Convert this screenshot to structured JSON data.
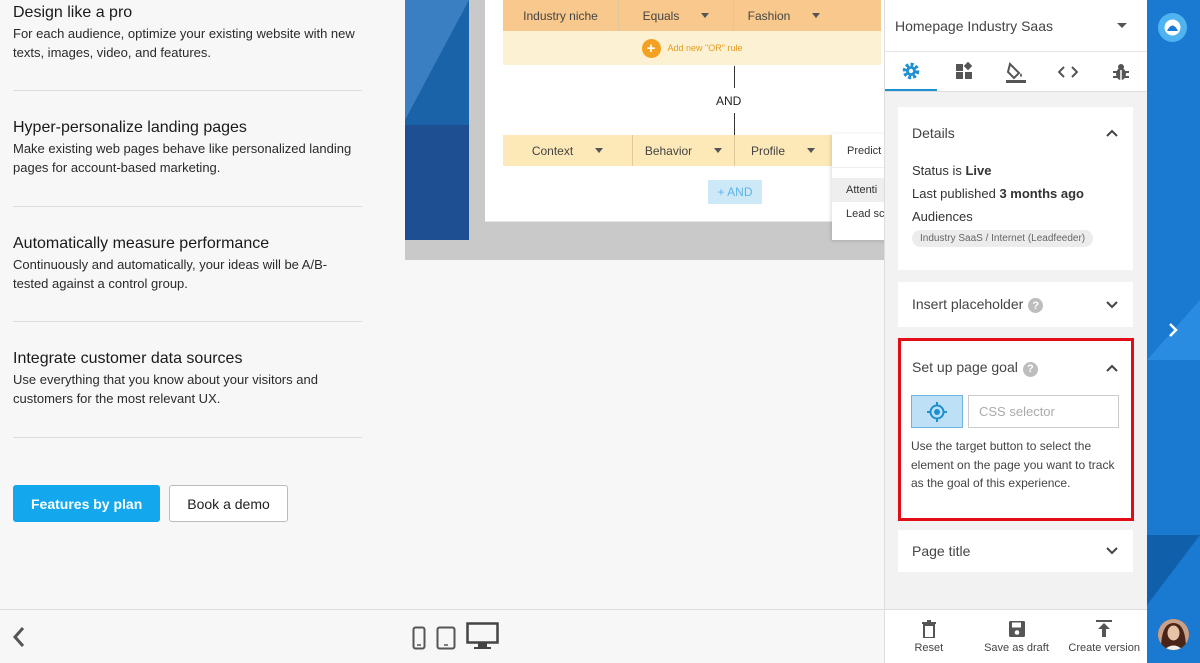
{
  "features": [
    {
      "title": "Design like a pro",
      "desc": "For each audience, optimize your existing website with new texts, images, video, and features."
    },
    {
      "title": "Hyper-personalize landing pages",
      "desc": "Make existing web pages behave like personalized landing pages for account-based marketing."
    },
    {
      "title": "Automatically measure performance",
      "desc": "Continuously and automatically, your ideas will be A/B-tested against a control group."
    },
    {
      "title": "Integrate customer data sources",
      "desc": "Use everything that you know about your visitors and customers for the most relevant UX."
    }
  ],
  "cta": {
    "primary": "Features by plan",
    "secondary": "Book a demo"
  },
  "preview": {
    "rule_top": [
      "Industry niche",
      "Equals",
      "Fashion"
    ],
    "add_or": "Add new \"OR\" rule",
    "and_label": "AND",
    "rule_context": [
      "Context",
      "Behavior",
      "Profile"
    ],
    "add_and": "+ AND",
    "dropdown": {
      "header": "Predict",
      "items": [
        "Attenti",
        "Lead sc"
      ]
    }
  },
  "panel": {
    "experience_name": "Homepage Industry Saas",
    "tabs": [
      "settings-icon",
      "widgets-icon",
      "paint-bucket-icon",
      "code-icon",
      "bug-icon"
    ],
    "details": {
      "title": "Details",
      "status_label": "Status is ",
      "status_value": "Live",
      "published_label": "Last published ",
      "published_value": "3 months ago",
      "audiences_label": "Audiences",
      "audience_chip": "Industry SaaS / Internet (Leadfeeder)"
    },
    "insert_placeholder": {
      "title": "Insert placeholder",
      "help": "?"
    },
    "page_goal": {
      "title": "Set up page goal",
      "help": "?",
      "selector_placeholder": "CSS selector",
      "help_text": "Use the target button to select the element on the page you want to track as the goal of this experience."
    },
    "page_title": {
      "title": "Page title"
    },
    "footer": {
      "reset": "Reset",
      "save_draft": "Save as draft",
      "create_version": "Create version"
    }
  },
  "colors": {
    "accent": "#13a7ee",
    "brand_blue": "#1a79d1",
    "highlight_red": "#e30d17",
    "rule_orange": "#f8c88c"
  }
}
